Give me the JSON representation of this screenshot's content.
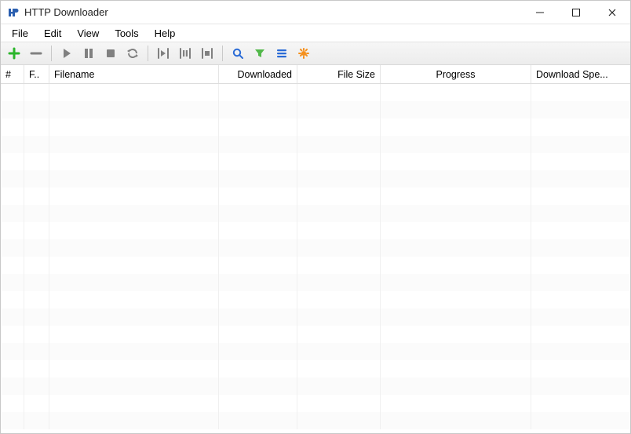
{
  "window": {
    "title": "HTTP Downloader"
  },
  "menu": {
    "file": "File",
    "edit": "Edit",
    "view": "View",
    "tools": "Tools",
    "help": "Help"
  },
  "toolbar": {
    "icons": {
      "add": "add-icon",
      "remove": "remove-icon",
      "start": "play-icon",
      "pause": "pause-icon",
      "stop": "stop-icon",
      "restart": "restart-icon",
      "queue_start": "queue-start-icon",
      "queue_pause": "queue-pause-icon",
      "queue_stop": "queue-stop-icon",
      "search": "search-icon",
      "filter": "filter-icon",
      "list": "list-icon",
      "options": "options-icon"
    },
    "colors": {
      "add": "#2bb52b",
      "remove": "#808080",
      "disabled": "#808080",
      "search": "#2a6bd6",
      "filter": "#52b84a",
      "list": "#2a6bd6",
      "options": "#f5901d"
    }
  },
  "columns": {
    "index": "#",
    "flag": "F..",
    "filename": "Filename",
    "downloaded": "Downloaded",
    "filesize": "File Size",
    "progress": "Progress",
    "speed": "Download Spe..."
  },
  "rows": []
}
